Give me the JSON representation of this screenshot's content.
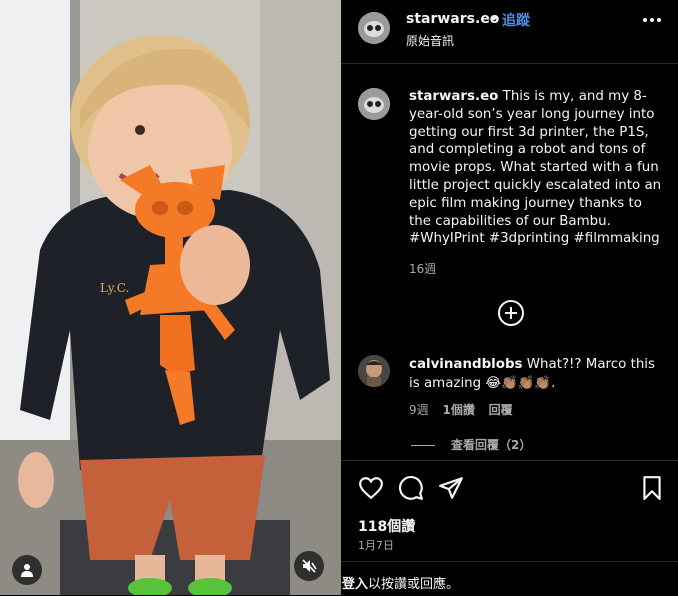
{
  "header": {
    "username": "starwars.eo",
    "dot": "•",
    "follow_label": "追蹤",
    "audio_label": "原始音訊"
  },
  "caption": {
    "username": "starwars.eo",
    "text": "This is my, and my 8-year-old son’s year long journey into getting our first 3d printer, the P1S, and completing a robot and tons of movie props. What started with a fun little project quickly escalated into an epic film making journey thanks to the capabilities of our Bambu. #WhyIPrint #3dprinting #filmmaking",
    "time": "16週"
  },
  "comment": {
    "username": "calvinandblobs",
    "text": "What?!? Marco this is amazing 😂👏🏽👏🏽👏🏽.",
    "time": "9週",
    "likes": "1個讚",
    "reply_label": "回覆",
    "view_replies": "查看回覆（2）"
  },
  "post": {
    "likes": "118個讚",
    "date": "1月7日"
  },
  "footer": {
    "login": "登入",
    "login_rest": "以按讚或回應。"
  },
  "icons": {
    "more": "more-options-icon",
    "add_comment": "plus-circle-icon",
    "like": "heart-icon",
    "comment": "comment-bubble-icon",
    "share": "paper-plane-icon",
    "save": "bookmark-icon",
    "mute": "speaker-muted-icon",
    "profile": "user-icon"
  },
  "colors": {
    "background": "#000000",
    "follow_link": "#4a90e2",
    "secondary_text": "#a8a8a8"
  }
}
